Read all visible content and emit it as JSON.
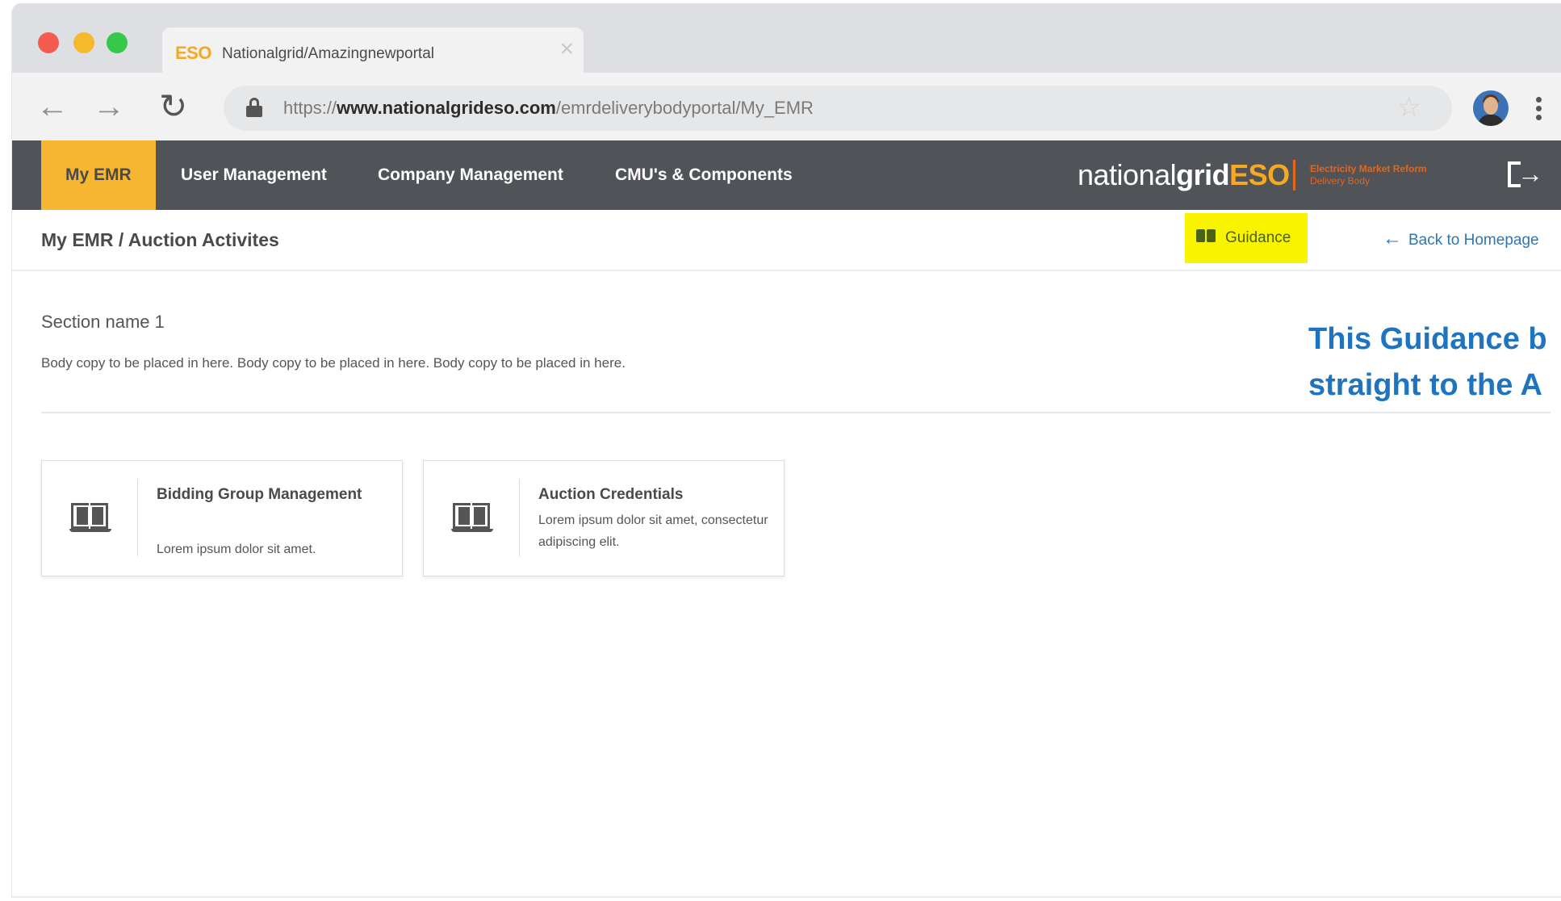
{
  "browser": {
    "tab": {
      "brand": "ESO",
      "title": "Nationalgrid/Amazingnewportal",
      "close_icon": "close-icon"
    },
    "url": {
      "prefix": "https://",
      "domain": "www.nationalgrideso.com",
      "path": "/emrdeliverybodyportal/My_EMR"
    },
    "icons": [
      "back-arrow-icon",
      "forward-arrow-icon",
      "reload-icon",
      "lock-icon",
      "star-icon",
      "avatar",
      "menu-kebab-icon"
    ]
  },
  "nav": {
    "items": [
      {
        "label": "My EMR",
        "active": true
      },
      {
        "label": "User Management",
        "active": false
      },
      {
        "label": "Company Management",
        "active": false
      },
      {
        "label": "CMU's & Components",
        "active": false
      }
    ],
    "brand": {
      "national": "national",
      "grid": "grid",
      "eso": "ESO"
    },
    "brand_sub": {
      "line1": "Electricity Market Reform",
      "line2": "Delivery Body"
    },
    "logout_icon": "logout-icon"
  },
  "subheader": {
    "breadcrumb": "My EMR / Auction Activites",
    "guidance_label": "Guidance",
    "back_label": "Back to Homepage"
  },
  "main": {
    "section_name": "Section name 1",
    "body_copy": "Body copy to be placed in here. Body copy to be placed in here. Body copy to be placed in here.",
    "cards": [
      {
        "title": "Bidding Group Management",
        "desc": "Lorem ipsum dolor sit amet.",
        "icon": "book-icon"
      },
      {
        "title": "Auction Credentials",
        "desc": "Lorem ipsum dolor sit amet, consectetur adipiscing elit.",
        "icon": "book-icon"
      }
    ]
  },
  "annotation": {
    "line1": "This Guidance b",
    "line2": "straight to the A"
  },
  "colors": {
    "nav_bg": "#505357",
    "accent": "#f6b631",
    "eso_orange": "#f7a823",
    "highlight": "#f8f400",
    "link_blue": "#2e75b6",
    "annotation_blue": "#1f74bf"
  }
}
